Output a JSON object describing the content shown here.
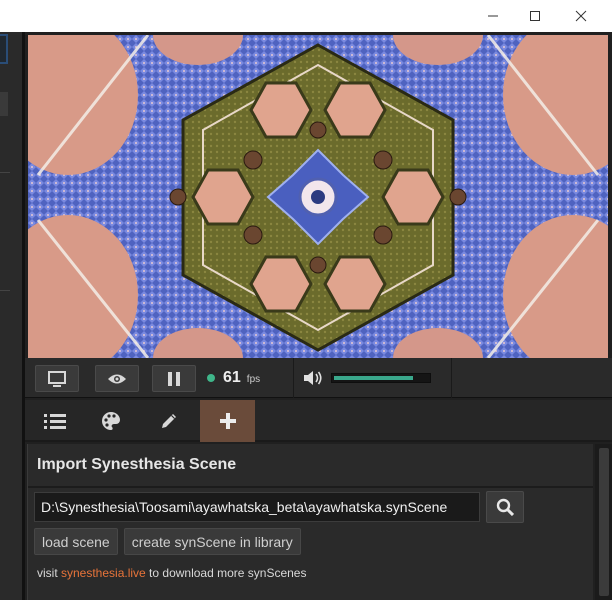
{
  "window": {
    "minimize_icon": "minimize-icon",
    "maximize_icon": "maximize-icon",
    "close_icon": "close-icon"
  },
  "preview": {
    "description_icon": "kaleidoscope-visual"
  },
  "controls": {
    "display_icon": "monitor-icon",
    "eye_icon": "eye-icon",
    "pause_icon": "pause-icon",
    "fps_value": "61",
    "fps_label": "fps",
    "volume_icon": "speaker-icon",
    "volume_level": 0.82,
    "status_color": "#3fb68a"
  },
  "tabs": [
    {
      "icon": "list-icon"
    },
    {
      "icon": "palette-icon"
    },
    {
      "icon": "pencil-icon"
    },
    {
      "icon": "plus-icon",
      "active": true
    }
  ],
  "import_panel": {
    "title": "Import Synesthesia Scene",
    "path_value": "D:\\Synesthesia\\Toosami\\ayawhatska_beta\\ayawhatska.synScene",
    "search_icon": "search-icon",
    "load_label": "load scene",
    "create_label": "create synScene in library",
    "visit_prefix": "visit ",
    "visit_link": "synesthesia.live",
    "visit_suffix": " to download more synScenes"
  },
  "colors": {
    "accent_tab": "#6a4b3a",
    "link": "#e8743a",
    "volume_fill": "#3aa88c"
  }
}
